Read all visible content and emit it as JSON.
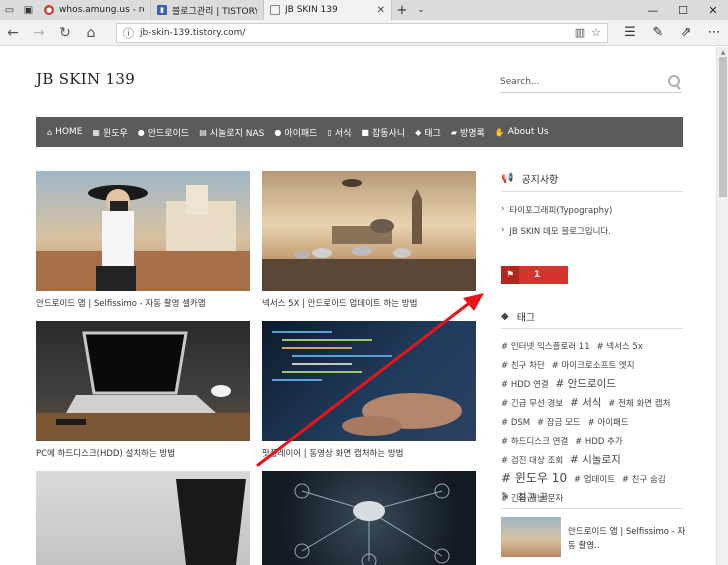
{
  "browser": {
    "tabs": [
      {
        "label": "whos.amung.us - real-time s",
        "favicon_color": "#d23b2a",
        "active": false
      },
      {
        "label": "블로그관리 | TISTORY",
        "favicon_color": "#3a63b7",
        "active": false
      },
      {
        "label": "JB SKIN 139",
        "favicon_color": "#888888",
        "active": true
      }
    ],
    "url": "jb-skin-139.tistory.com/"
  },
  "site": {
    "title": "JB SKIN 139",
    "search_placeholder": "Search..."
  },
  "menu": [
    {
      "label": "HOME",
      "icon": "home-icon",
      "glyph": "⌂"
    },
    {
      "label": "윈도우",
      "icon": "windows-icon",
      "glyph": "▦"
    },
    {
      "label": "안드로이드",
      "icon": "android-icon",
      "glyph": "●"
    },
    {
      "label": "시놀로지 NAS",
      "icon": "server-icon",
      "glyph": "▤"
    },
    {
      "label": "아이패드",
      "icon": "apple-icon",
      "glyph": "●"
    },
    {
      "label": "서식",
      "icon": "document-icon",
      "glyph": "▯"
    },
    {
      "label": "잡동사니",
      "icon": "box-icon",
      "glyph": "■"
    },
    {
      "label": "태그",
      "icon": "tags-icon",
      "glyph": "◆"
    },
    {
      "label": "방명록",
      "icon": "book-icon",
      "glyph": "▰"
    },
    {
      "label": "About Us",
      "icon": "thumbs-up-icon",
      "glyph": "✋"
    }
  ],
  "posts": [
    {
      "title": "안드로이드 앱 | Selfissimo - 자동 촬영 셀카앱"
    },
    {
      "title": "넥서스 5X | 안드로이드 업데이트 하는 방법"
    },
    {
      "title": "PC에 하드디스크(HDD) 설치하는 방법"
    },
    {
      "title": "팟플레이어 | 동영상 화면 캡처하는 방법"
    }
  ],
  "sidebar": {
    "notice_title": "공지사항",
    "notices": [
      "타이포그래피(Typography)",
      "JB SKIN 데모 블로그입니다."
    ],
    "counter_value": "1",
    "tags_title": "태그",
    "tags": [
      {
        "label": "# 인터넷 익스플로러 11",
        "size": "sm"
      },
      {
        "label": "# 넥서스 5x",
        "size": "sm"
      },
      {
        "label": "# 친구 차단",
        "size": "sm"
      },
      {
        "label": "# 마이크로소프트 엣지",
        "size": "sm"
      },
      {
        "label": "# HDD 연결",
        "size": "sm"
      },
      {
        "label": "# 안드로이드",
        "size": "lg"
      },
      {
        "label": "# 긴급 무선 경보",
        "size": "sm"
      },
      {
        "label": "# 서식",
        "size": "lg"
      },
      {
        "label": "# 전체 화면 캡처",
        "size": "sm"
      },
      {
        "label": "# DSM",
        "size": "sm"
      },
      {
        "label": "# 잠금 모드",
        "size": "sm"
      },
      {
        "label": "# 아이패드",
        "size": "sm"
      },
      {
        "label": "# 하드디스크 연결",
        "size": "sm"
      },
      {
        "label": "# HDD 추가",
        "size": "sm"
      },
      {
        "label": "# 검진 대상 조회",
        "size": "sm"
      },
      {
        "label": "# 시놀로지",
        "size": "lg"
      },
      {
        "label": "# 윈도우 10",
        "size": "xl"
      },
      {
        "label": "# 업데이트",
        "size": "sm"
      },
      {
        "label": "# 친구 숨김",
        "size": "sm"
      },
      {
        "label": "# 긴급 재난 문자",
        "size": "sm"
      }
    ],
    "recent_title": "최근 글",
    "recent_post": "안드로이드 앱 | Selfissimo - 자동 촬영.."
  },
  "colors": {
    "menu_bg": "#5b5b5b",
    "counter_red": "#d6322e",
    "annotation_arrow": "#e8141c"
  }
}
